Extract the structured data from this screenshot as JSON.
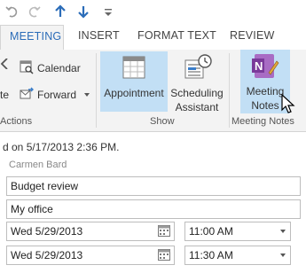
{
  "quick_access": {
    "undo_icon": "undo-icon",
    "redo_icon": "redo-icon",
    "up_icon": "up-arrow-icon",
    "down_icon": "down-arrow-icon",
    "customize_icon": "customize-dropdown-icon"
  },
  "tabs": [
    {
      "label": "MEETING",
      "active": true
    },
    {
      "label": "INSERT",
      "active": false
    },
    {
      "label": "FORMAT TEXT",
      "active": false
    },
    {
      "label": "REVIEW",
      "active": false
    }
  ],
  "ribbon": {
    "actions": {
      "partial_label": "te",
      "calendar_label": "Calendar",
      "forward_label": "Forward",
      "group_label": "Actions"
    },
    "show": {
      "appointment_label": "Appointment",
      "scheduling_line1": "Scheduling",
      "scheduling_line2": "Assistant",
      "group_label": "Show"
    },
    "meeting_notes": {
      "line1": "Meeting",
      "line2": "Notes",
      "group_label": "Meeting Notes"
    }
  },
  "message": {
    "status": "d on 5/17/2013 2:36 PM.",
    "organizer": "Carmen Bard",
    "subject": "Budget review",
    "location": "My office",
    "start_date": "Wed 5/29/2013",
    "start_time": "11:00 AM",
    "end_date": "Wed 5/29/2013",
    "end_time": "11:30 AM"
  },
  "colors": {
    "accent": "#2b6cb8",
    "highlight": "#c2dff5",
    "onenote_purple": "#7a3a9a"
  }
}
